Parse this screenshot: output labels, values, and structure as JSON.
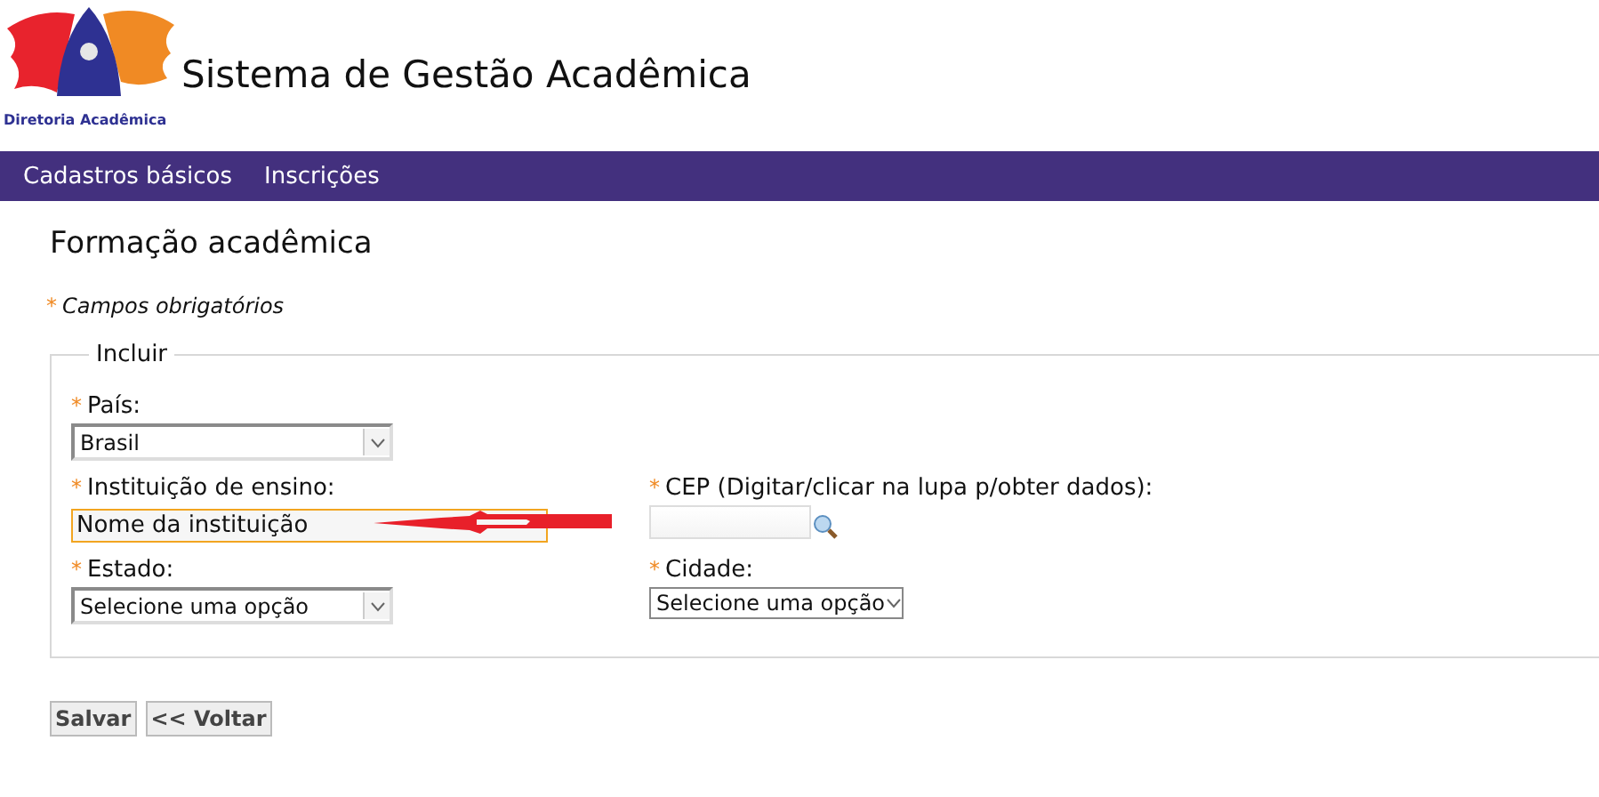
{
  "logo": {
    "caption": "Diretoria Acadêmica"
  },
  "app_title": "Sistema de Gestão Acadêmica",
  "menu": [
    {
      "label": "Cadastros básicos"
    },
    {
      "label": "Inscrições"
    }
  ],
  "page_title": "Formação acadêmica",
  "required_note": {
    "mark": "*",
    "text": "Campos obrigatórios"
  },
  "fieldset": {
    "legend": "Incluir",
    "rows": [
      [
        {
          "kind": "select",
          "mark": "*",
          "label": "País:",
          "value": "Brasil"
        }
      ],
      [
        {
          "kind": "text",
          "mark": "*",
          "label": "Instituição de ensino:",
          "placeholder": "Nome da instituição",
          "focused": true
        },
        {
          "kind": "cep",
          "mark": "*",
          "label": "CEP (Digitar/clicar na lupa p/obter dados):"
        }
      ],
      [
        {
          "kind": "select",
          "mark": "*",
          "label": "Estado:",
          "value": "Selecione uma opção"
        },
        {
          "kind": "select",
          "mark": "*",
          "label": "Cidade:",
          "value": "Selecione uma opção"
        }
      ]
    ]
  },
  "buttons": [
    {
      "label": "Salvar"
    },
    {
      "label": "<< Voltar"
    }
  ]
}
